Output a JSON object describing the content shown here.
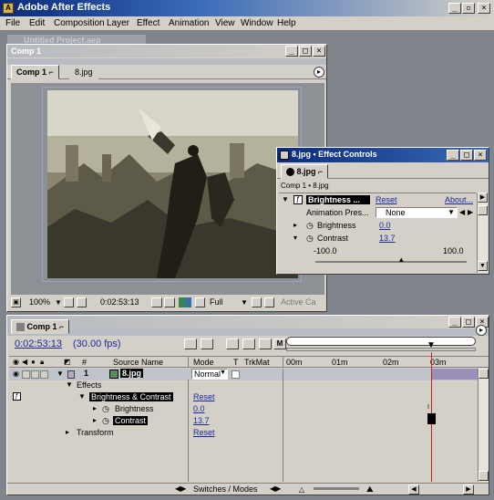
{
  "app": {
    "title": "Adobe After Effects",
    "icon_letter": "A"
  },
  "menu": [
    "File",
    "Edit",
    "Composition",
    "Layer",
    "Effect",
    "Animation",
    "View",
    "Window",
    "Help"
  ],
  "project_window": {
    "title": "Untitled Project.aep"
  },
  "comp_window": {
    "title": "Comp 1",
    "tabs": [
      "Comp 1",
      "8.jpg"
    ],
    "footer": {
      "zoom": "100%",
      "timecode": "0:02:53:13",
      "resolution": "Full",
      "camera": "Active Ca"
    }
  },
  "effect_controls": {
    "title": "8.jpg • Effect Controls",
    "tab": "8.jpg",
    "breadcrumb": "Comp 1 • 8.jpg",
    "effect_name": "Brightness ...",
    "reset_label": "Reset",
    "about_label": "About...",
    "anim_presets_label": "Animation Pres...",
    "anim_presets_value": "None",
    "brightness_label": "Brightness",
    "brightness_value": "0.0",
    "contrast_label": "Contrast",
    "contrast_value": "13.7",
    "slider_min": "-100.0",
    "slider_max": "100.0",
    "contrast_fraction": 0.5685
  },
  "timeline": {
    "tab": "Comp 1",
    "timecode": "0:02:53:13",
    "fps": "(30.00 fps)",
    "headers": {
      "num": "#",
      "source": "Source Name",
      "mode": "Mode",
      "t": "T",
      "trkmat": "TrkMat"
    },
    "ruler": [
      "00m",
      "01m",
      "02m",
      "03m"
    ],
    "layer": {
      "num": "1",
      "name": "8.jpg",
      "mode": "Normal"
    },
    "effects_label": "Effects",
    "effect_name": "Brightness & Contrast",
    "effect_reset": "Reset",
    "brightness_label": "Brightness",
    "brightness_value": "0.0",
    "contrast_label": "Contrast",
    "contrast_value": "13.7",
    "transform_label": "Transform",
    "transform_reset": "Reset",
    "switches_label": "Switches / Modes"
  }
}
